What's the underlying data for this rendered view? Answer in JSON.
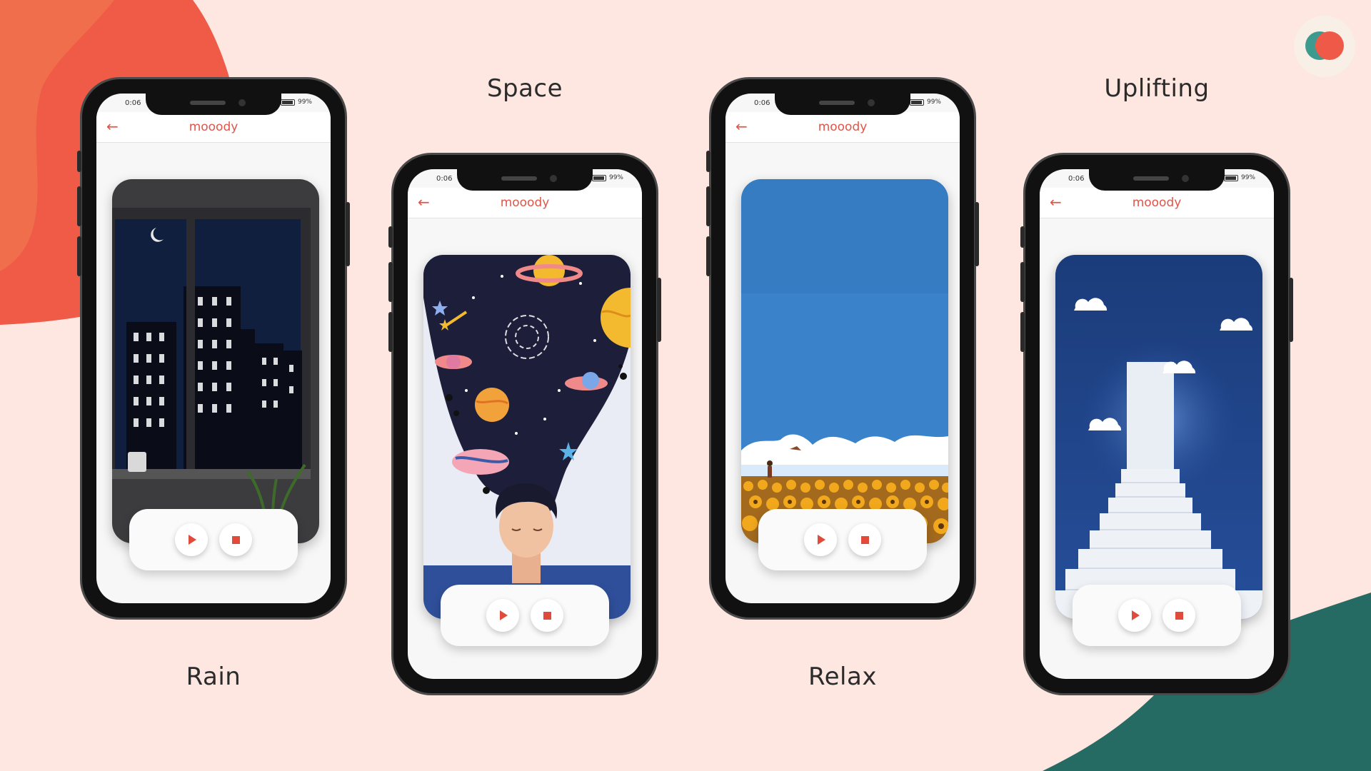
{
  "colors": {
    "background": "#fde7e0",
    "accent": "#e05548",
    "blob_red": "#ef5b46",
    "blob_green": "#256b63"
  },
  "app": {
    "title": "mooody",
    "back_icon": "arrow-left-icon"
  },
  "status": {
    "time": "0:06",
    "battery": "99%"
  },
  "phones": [
    {
      "caption": "Rain",
      "scene": "rain"
    },
    {
      "caption": "Space",
      "scene": "space"
    },
    {
      "caption": "Relax",
      "scene": "relax"
    },
    {
      "caption": "Uplifting",
      "scene": "uplifting"
    }
  ],
  "controls": {
    "play_icon": "play-icon",
    "stop_icon": "stop-icon"
  }
}
